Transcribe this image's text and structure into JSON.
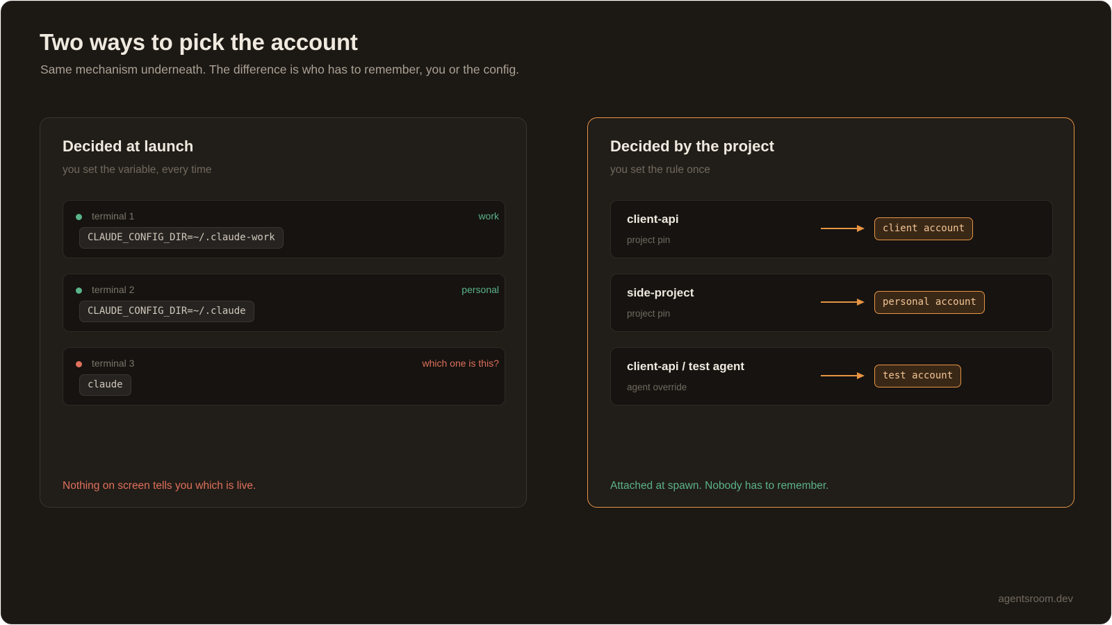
{
  "header": {
    "title": "Two ways to pick the account",
    "subtitle": "Same mechanism underneath. The difference is who has to remember, you or the config."
  },
  "left_panel": {
    "heading": "Decided at launch",
    "subheading": "you set the variable, every time",
    "terminals": [
      {
        "label": "terminal 1",
        "tag": "work",
        "command": "CLAUDE_CONFIG_DIR=~/.claude-work",
        "status": "green"
      },
      {
        "label": "terminal 2",
        "tag": "personal",
        "command": "CLAUDE_CONFIG_DIR=~/.claude",
        "status": "green"
      },
      {
        "label": "terminal 3",
        "tag": "which one is this?",
        "command": "claude",
        "status": "red"
      }
    ],
    "footer": "Nothing on screen tells you which is live."
  },
  "right_panel": {
    "heading": "Decided by the project",
    "subheading": "you set the rule once",
    "rules": [
      {
        "name": "client-api",
        "kind": "project pin",
        "account": "client account"
      },
      {
        "name": "side-project",
        "kind": "project pin",
        "account": "personal account"
      },
      {
        "name": "client-api / test agent",
        "kind": "agent override",
        "account": "test account"
      }
    ],
    "footer": "Attached at spawn. Nobody has to remember."
  },
  "brand": "agentsroom.dev",
  "colors": {
    "background": "#1c1814",
    "accent": "#e89444",
    "ok": "#5bb38a",
    "warn": "#e0705c"
  },
  "icons": {
    "status": "dot-icon",
    "mapping": "arrow-right-icon"
  }
}
